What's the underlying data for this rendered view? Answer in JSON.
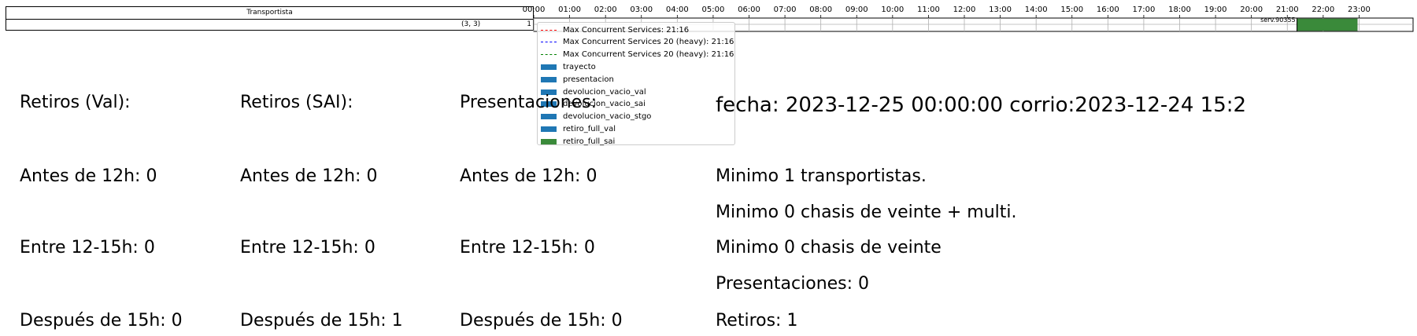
{
  "header": {
    "column_title": "Transportista",
    "coords": "(3, 3)",
    "row_id": "1"
  },
  "chart_data": {
    "type": "gantt",
    "time_unit": "hours",
    "xlim": [
      0,
      24
    ],
    "ticks": [
      "00:00",
      "01:00",
      "02:00",
      "03:00",
      "04:00",
      "05:00",
      "06:00",
      "07:00",
      "08:00",
      "09:00",
      "10:00",
      "11:00",
      "12:00",
      "13:00",
      "14:00",
      "15:00",
      "16:00",
      "17:00",
      "18:00",
      "19:00",
      "20:00",
      "21:00",
      "22:00",
      "23:00"
    ],
    "bars": [
      {
        "label": "serv.90355",
        "start": 21.27,
        "end": 22.95,
        "category": "retiro_full_sai"
      }
    ],
    "reference_lines": [
      {
        "name": "Max Concurrent Services: 21:16",
        "color": "#ff0000",
        "at": "21:16"
      },
      {
        "name": "Max Concurrent Services 20 (heavy): 21:16",
        "color": "#0000ff",
        "at": "21:16"
      },
      {
        "name": "Max Concurrent Services 20 (heavy): 21:16",
        "color": "#008000",
        "at": "21:16"
      }
    ],
    "legend": [
      {
        "label": "Max Concurrent Services: 21:16",
        "kind": "line",
        "color": "#ff0000"
      },
      {
        "label": "Max Concurrent Services 20 (heavy): 21:16",
        "kind": "line",
        "color": "#0000ff"
      },
      {
        "label": "Max Concurrent Services 20 (heavy): 21:16",
        "kind": "line",
        "color": "#008000"
      },
      {
        "label": "trayecto",
        "kind": "box",
        "color": "#1f77b4"
      },
      {
        "label": "presentacion",
        "kind": "box",
        "color": "#1f77b4"
      },
      {
        "label": "devolucion_vacio_val",
        "kind": "box",
        "color": "#1f77b4"
      },
      {
        "label": "devolucion_vacio_sai",
        "kind": "box",
        "color": "#1f77b4"
      },
      {
        "label": "devolucion_vacio_stgo",
        "kind": "box",
        "color": "#1f77b4"
      },
      {
        "label": "retiro_full_val",
        "kind": "box",
        "color": "#1f77b4"
      },
      {
        "label": "retiro_full_sai",
        "kind": "box",
        "color": "#3a8a3a"
      }
    ],
    "legend_placement": "top-left of timeline"
  },
  "summary": {
    "col_val": {
      "title": "Retiros (Val):",
      "antes": "Antes de 12h: 0",
      "entre": "Entre 12-15h: 0",
      "despues": "Después de 15h: 0"
    },
    "col_sai": {
      "title": "Retiros (SAI):",
      "antes": "Antes de 12h: 0",
      "entre": "Entre 12-15h: 0",
      "despues": "Después de 15h: 1"
    },
    "col_pres": {
      "title": "Presentaciones:",
      "antes": "Antes de 12h: 0",
      "entre": "Entre 12-15h: 0",
      "despues": "Después de 15h: 0"
    },
    "info": {
      "fecha": "fecha: 2023-12-25 00:00:00  corrio:2023-12-24 15:2",
      "min_transportistas": "Minimo 1 transportistas.",
      "min_chasis_multi": "Minimo 0 chasis de veinte + multi.",
      "min_chasis": "Minimo 0 chasis de veinte",
      "presentaciones": "Presentaciones: 0",
      "retiros": "Retiros: 1"
    }
  }
}
